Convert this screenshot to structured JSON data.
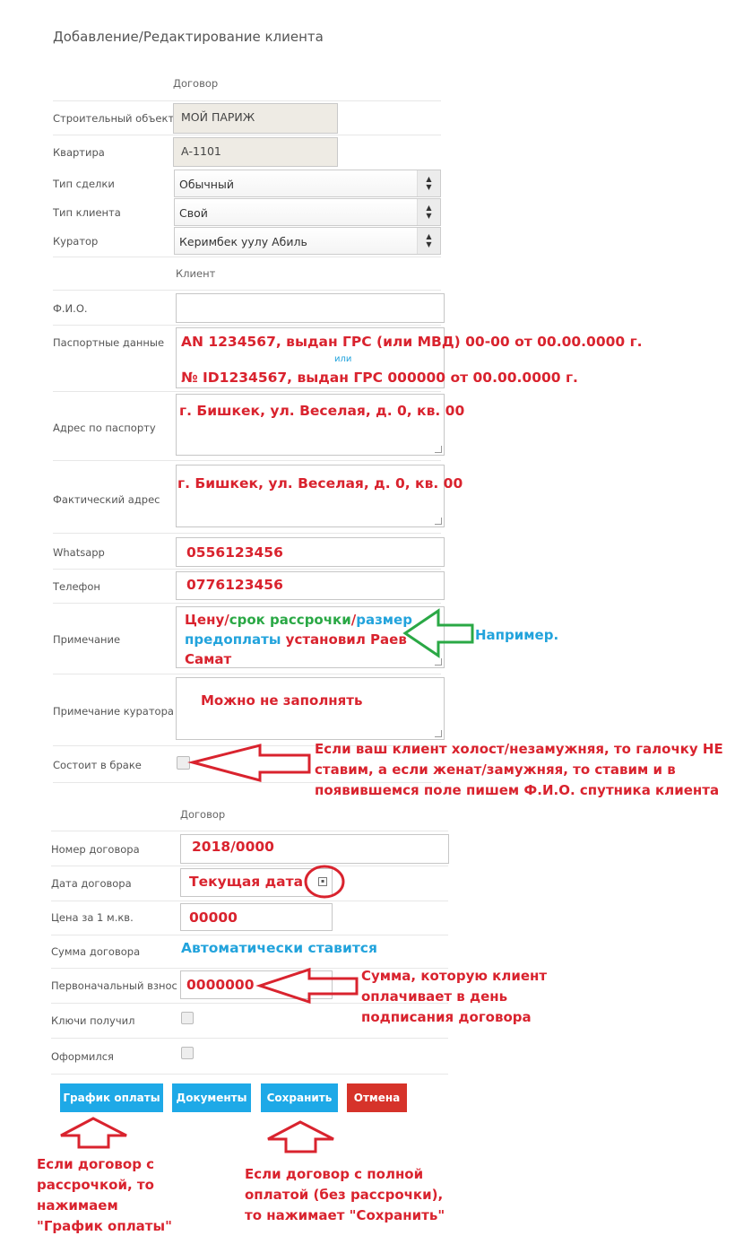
{
  "page_title": "Добавление/Редактирование клиента",
  "section1": {
    "header": "Договор",
    "rows": {
      "object": {
        "label": "Строительный объект",
        "value": "МОЙ ПАРИЖ"
      },
      "apartment": {
        "label": "Квартира",
        "value": "А-1101"
      },
      "deal_type": {
        "label": "Тип сделки",
        "value": "Обычный"
      },
      "client_type": {
        "label": "Тип клиента",
        "value": "Свой"
      },
      "curator": {
        "label": "Куратор",
        "value": "Керимбек уулу Абиль"
      }
    }
  },
  "section2": {
    "header": "Клиент",
    "fio": {
      "label": "Ф.И.О.",
      "value": ""
    },
    "passport": {
      "label": "Паспортные данные",
      "line1": "AN 1234567, выдан ГРС (или МВД) 00-00 от 00.00.0000 г.",
      "or": "или",
      "line2": "№ ID1234567, выдан ГРС 000000 от 00.00.0000 г."
    },
    "passport_address": {
      "label": "Адрес по паспорту",
      "value": "г. Бишкек, ул. Веселая, д. 0, кв. 00"
    },
    "actual_address": {
      "label": "Фактический адрес",
      "value": "г. Бишкек, ул. Веселая, д. 0, кв. 00"
    },
    "whatsapp": {
      "label": "Whatsapp",
      "value": "0556123456"
    },
    "phone": {
      "label": "Телефон",
      "value": "0776123456"
    },
    "note": {
      "label": "Примечание",
      "part1": "Цену/",
      "part2": "срок рассрочки",
      "part3": "/",
      "part4": "размер",
      "part5": "предоплаты",
      "part6": " установил Раев",
      "part7": "Самат"
    },
    "curator_note": {
      "label": "Примечание куратора",
      "value": "Можно не заполнять"
    },
    "married": {
      "label": "Состоит в браке",
      "checked": false
    }
  },
  "section3": {
    "header": "Договор",
    "contract_number": {
      "label": "Номер договора",
      "value": "2018/0000"
    },
    "contract_date": {
      "label": "Дата договора",
      "value": "Текущая дата"
    },
    "price_per_m2": {
      "label": "Цена за 1 м.кв.",
      "value": "00000"
    },
    "contract_sum": {
      "label": "Сумма договора",
      "value": "Автоматически ставится"
    },
    "down_payment": {
      "label": "Первоначальный взнос",
      "value": "0000000"
    },
    "keys_received": {
      "label": "Ключи получил",
      "checked": false
    },
    "registered": {
      "label": "Оформился",
      "checked": false
    }
  },
  "buttons": {
    "schedule": "График оплаты",
    "documents": "Документы",
    "save": "Сохранить",
    "cancel": "Отмена"
  },
  "annotations": {
    "example": "Например.",
    "married": [
      "Если ваш клиент холост/незамужняя, то галочку НЕ",
      "ставим, а если женат/замужняя, то ставим и в",
      "появившемся поле пишем Ф.И.О. спутника клиента"
    ],
    "down_payment": [
      "Сумма, которую клиент",
      "оплачивает в день",
      "подписания договора"
    ],
    "schedule": [
      "Если договор с",
      "рассрочкой, то",
      "нажимаем",
      "\"График оплаты\""
    ],
    "save": [
      "Если договор с полной",
      "оплатой (без рассрочки),",
      "то нажимает \"Сохранить\""
    ]
  },
  "colors": {
    "annotation_red": "#d9232e",
    "annotation_green": "#2aa845",
    "annotation_blue": "#22a3dc",
    "button_blue": "#1ea9e7",
    "button_red": "#d6332a"
  }
}
